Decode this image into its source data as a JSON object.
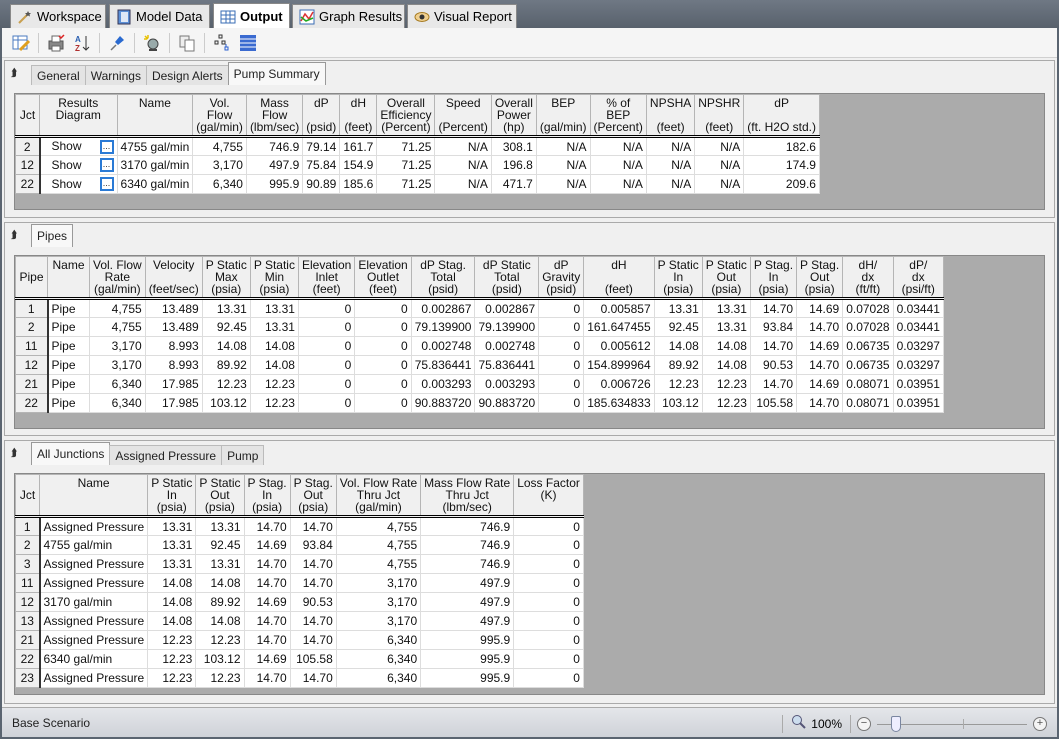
{
  "main_tabs": [
    {
      "label": "Workspace",
      "icon": "wand-icon"
    },
    {
      "label": "Model Data",
      "icon": "notebook-icon"
    },
    {
      "label": "Output",
      "icon": "table-icon",
      "active": true
    },
    {
      "label": "Graph Results",
      "icon": "graph-icon"
    },
    {
      "label": "Visual Report",
      "icon": "eye-icon"
    }
  ],
  "toolbar": [
    "edit-table-icon",
    "print-icon",
    "sort-az-icon",
    "pin-icon",
    "lamp-icon",
    "copy-icon",
    "hierarchy-icon",
    "list-icon"
  ],
  "pump_panel": {
    "tabs": [
      "General",
      "Warnings",
      "Design Alerts",
      "Pump Summary"
    ],
    "active_tab": "Pump Summary",
    "columns": [
      "Jct",
      "Results\nDiagram",
      "Name",
      "Vol.\nFlow\n(gal/min)",
      "Mass\nFlow\n(lbm/sec)",
      "dP\n\n(psid)",
      "dH\n\n(feet)",
      "Overall\nEfficiency\n(Percent)",
      "Speed\n\n(Percent)",
      "Overall\nPower\n(hp)",
      "BEP\n\n(gal/min)",
      "% of\nBEP\n(Percent)",
      "NPSHA\n\n(feet)",
      "NPSHR\n\n(feet)",
      "dP\n\n(ft. H2O std.)"
    ],
    "rows": [
      [
        "2",
        "Show",
        "4755 gal/min",
        "4,755",
        "746.9",
        "79.14",
        "161.7",
        "71.25",
        "N/A",
        "308.1",
        "N/A",
        "N/A",
        "N/A",
        "N/A",
        "182.6"
      ],
      [
        "12",
        "Show",
        "3170 gal/min",
        "3,170",
        "497.9",
        "75.84",
        "154.9",
        "71.25",
        "N/A",
        "196.8",
        "N/A",
        "N/A",
        "N/A",
        "N/A",
        "174.9"
      ],
      [
        "22",
        "Show",
        "6340 gal/min",
        "6,340",
        "995.9",
        "90.89",
        "185.6",
        "71.25",
        "N/A",
        "471.7",
        "N/A",
        "N/A",
        "N/A",
        "N/A",
        "209.6"
      ]
    ]
  },
  "pipes_panel": {
    "tabs": [
      "Pipes"
    ],
    "active_tab": "Pipes",
    "columns": [
      "Pipe",
      "Name",
      "Vol. Flow\nRate\n(gal/min)",
      "Velocity\n\n(feet/sec)",
      "P Static\nMax\n(psia)",
      "P Static\nMin\n(psia)",
      "Elevation\nInlet\n(feet)",
      "Elevation\nOutlet\n(feet)",
      "dP Stag.\nTotal\n(psid)",
      "dP Static\nTotal\n(psid)",
      "dP\nGravity\n(psid)",
      "dH\n\n(feet)",
      "P Static\nIn\n(psia)",
      "P Static\nOut\n(psia)",
      "P Stag.\nIn\n(psia)",
      "P Stag.\nOut\n(psia)",
      "dH/\ndx\n(ft/ft)",
      "dP/\ndx\n(psi/ft)"
    ],
    "rows": [
      [
        "1",
        "Pipe",
        "4,755",
        "13.489",
        "13.31",
        "13.31",
        "0",
        "0",
        "0.002867",
        "0.002867",
        "0",
        "0.005857",
        "13.31",
        "13.31",
        "14.70",
        "14.69",
        "0.07028",
        "0.03441"
      ],
      [
        "2",
        "Pipe",
        "4,755",
        "13.489",
        "92.45",
        "13.31",
        "0",
        "0",
        "79.139900",
        "79.139900",
        "0",
        "161.647455",
        "92.45",
        "13.31",
        "93.84",
        "14.70",
        "0.07028",
        "0.03441"
      ],
      [
        "11",
        "Pipe",
        "3,170",
        "8.993",
        "14.08",
        "14.08",
        "0",
        "0",
        "0.002748",
        "0.002748",
        "0",
        "0.005612",
        "14.08",
        "14.08",
        "14.70",
        "14.69",
        "0.06735",
        "0.03297"
      ],
      [
        "12",
        "Pipe",
        "3,170",
        "8.993",
        "89.92",
        "14.08",
        "0",
        "0",
        "75.836441",
        "75.836441",
        "0",
        "154.899964",
        "89.92",
        "14.08",
        "90.53",
        "14.70",
        "0.06735",
        "0.03297"
      ],
      [
        "21",
        "Pipe",
        "6,340",
        "17.985",
        "12.23",
        "12.23",
        "0",
        "0",
        "0.003293",
        "0.003293",
        "0",
        "0.006726",
        "12.23",
        "12.23",
        "14.70",
        "14.69",
        "0.08071",
        "0.03951"
      ],
      [
        "22",
        "Pipe",
        "6,340",
        "17.985",
        "103.12",
        "12.23",
        "0",
        "0",
        "90.883720",
        "90.883720",
        "0",
        "185.634833",
        "103.12",
        "12.23",
        "105.58",
        "14.70",
        "0.08071",
        "0.03951"
      ]
    ]
  },
  "junctions_panel": {
    "tabs": [
      "All Junctions",
      "Assigned Pressure",
      "Pump"
    ],
    "active_tab": "All Junctions",
    "columns": [
      "Jct",
      "Name",
      "P Static\nIn\n(psia)",
      "P Static\nOut\n(psia)",
      "P Stag.\nIn\n(psia)",
      "P Stag.\nOut\n(psia)",
      "Vol. Flow Rate\nThru Jct\n(gal/min)",
      "Mass Flow Rate\nThru Jct\n(lbm/sec)",
      "Loss Factor\n(K)"
    ],
    "rows": [
      [
        "1",
        "Assigned Pressure",
        "13.31",
        "13.31",
        "14.70",
        "14.70",
        "4,755",
        "746.9",
        "0"
      ],
      [
        "2",
        "4755 gal/min",
        "13.31",
        "92.45",
        "14.69",
        "93.84",
        "4,755",
        "746.9",
        "0"
      ],
      [
        "3",
        "Assigned Pressure",
        "13.31",
        "13.31",
        "14.70",
        "14.70",
        "4,755",
        "746.9",
        "0"
      ],
      [
        "11",
        "Assigned Pressure",
        "14.08",
        "14.08",
        "14.70",
        "14.70",
        "3,170",
        "497.9",
        "0"
      ],
      [
        "12",
        "3170 gal/min",
        "14.08",
        "89.92",
        "14.69",
        "90.53",
        "3,170",
        "497.9",
        "0"
      ],
      [
        "13",
        "Assigned Pressure",
        "14.08",
        "14.08",
        "14.70",
        "14.70",
        "3,170",
        "497.9",
        "0"
      ],
      [
        "21",
        "Assigned Pressure",
        "12.23",
        "12.23",
        "14.70",
        "14.70",
        "6,340",
        "995.9",
        "0"
      ],
      [
        "22",
        "6340 gal/min",
        "12.23",
        "103.12",
        "14.69",
        "105.58",
        "6,340",
        "995.9",
        "0"
      ],
      [
        "23",
        "Assigned Pressure",
        "12.23",
        "12.23",
        "14.70",
        "14.70",
        "6,340",
        "995.9",
        "0"
      ]
    ]
  },
  "statusbar": {
    "scenario": "Base Scenario",
    "zoom": "100%",
    "zoom_fraction": 0.1
  },
  "colors": {
    "accent_button": "#2a7ad5",
    "grid_background": "#ababab"
  }
}
